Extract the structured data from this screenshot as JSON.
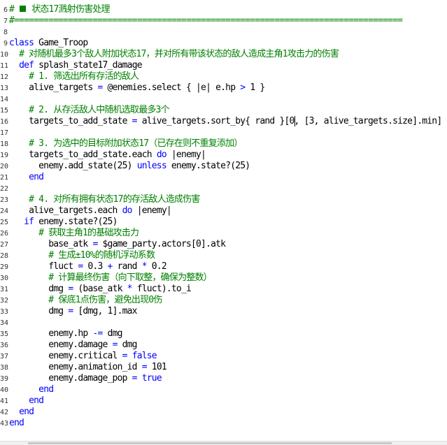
{
  "editor": {
    "language": "Ruby (RGSS script)",
    "colors": {
      "comment": "#008000",
      "keyword": "#0000ff",
      "text": "#000000",
      "background": "#ffffff"
    },
    "caret": {
      "line": 16
    },
    "lines": [
      {
        "num": "6",
        "tokens": [
          {
            "t": "comment",
            "v": "# "
          },
          {
            "t": "icon",
            "v": "■"
          },
          {
            "t": "comment",
            "v": " 状态17溅射伤害处理"
          }
        ]
      },
      {
        "num": "7",
        "tokens": [
          {
            "t": "comment",
            "v": "#==============================================================================="
          }
        ]
      },
      {
        "num": "8",
        "tokens": []
      },
      {
        "num": "9",
        "tokens": [
          {
            "t": "keyword",
            "v": "class"
          },
          {
            "t": "text",
            "v": " Game_Troop"
          }
        ]
      },
      {
        "num": "10",
        "tokens": [
          {
            "t": "text",
            "v": "  "
          },
          {
            "t": "comment",
            "v": "# 对随机最多3个敌人附加状态17，并对所有带该状态的敌人造成主角1攻击力的伤害"
          }
        ]
      },
      {
        "num": "11",
        "tokens": [
          {
            "t": "text",
            "v": "  "
          },
          {
            "t": "keyword",
            "v": "def"
          },
          {
            "t": "text",
            "v": " splash_state17_damage"
          }
        ]
      },
      {
        "num": "12",
        "tokens": [
          {
            "t": "text",
            "v": "    "
          },
          {
            "t": "comment",
            "v": "# 1. 筛选出所有存活的敌人"
          }
        ]
      },
      {
        "num": "13",
        "tokens": [
          {
            "t": "text",
            "v": "    alive_targets "
          },
          {
            "t": "keyword",
            "v": "="
          },
          {
            "t": "text",
            "v": " @enemies.select { |e| e.hp "
          },
          {
            "t": "keyword",
            "v": ">"
          },
          {
            "t": "text",
            "v": " 1 }"
          }
        ]
      },
      {
        "num": "14",
        "tokens": []
      },
      {
        "num": "15",
        "tokens": [
          {
            "t": "text",
            "v": "    "
          },
          {
            "t": "comment",
            "v": "# 2. 从存活敌人中随机选取最多3个"
          }
        ]
      },
      {
        "num": "16",
        "tokens": [
          {
            "t": "text",
            "v": "    targets_to_add_state "
          },
          {
            "t": "keyword",
            "v": "="
          },
          {
            "t": "text",
            "v": " alive_targets.sort_by{ rand }[0, [3, alive_targets.size].min]"
          }
        ]
      },
      {
        "num": "17",
        "tokens": []
      },
      {
        "num": "18",
        "tokens": [
          {
            "t": "text",
            "v": "    "
          },
          {
            "t": "comment",
            "v": "# 3. 为选中的目标附加状态17（已存在则不重复添加）"
          }
        ]
      },
      {
        "num": "19",
        "tokens": [
          {
            "t": "text",
            "v": "    targets_to_add_state.each "
          },
          {
            "t": "keyword",
            "v": "do"
          },
          {
            "t": "text",
            "v": " |enemy|"
          }
        ]
      },
      {
        "num": "20",
        "tokens": [
          {
            "t": "text",
            "v": "      enemy.add_state(25) "
          },
          {
            "t": "keyword",
            "v": "unless"
          },
          {
            "t": "text",
            "v": " enemy.state?(25)"
          }
        ]
      },
      {
        "num": "21",
        "tokens": [
          {
            "t": "text",
            "v": "    "
          },
          {
            "t": "keyword",
            "v": "end"
          }
        ]
      },
      {
        "num": "22",
        "tokens": []
      },
      {
        "num": "23",
        "tokens": [
          {
            "t": "text",
            "v": "    "
          },
          {
            "t": "comment",
            "v": "# 4. 对所有拥有状态17的存活敌人造成伤害"
          }
        ]
      },
      {
        "num": "24",
        "tokens": [
          {
            "t": "text",
            "v": "    alive_targets.each "
          },
          {
            "t": "keyword",
            "v": "do"
          },
          {
            "t": "text",
            "v": " |enemy|"
          }
        ]
      },
      {
        "num": "25",
        "tokens": [
          {
            "t": "text",
            "v": "   "
          },
          {
            "t": "keyword",
            "v": "if"
          },
          {
            "t": "text",
            "v": " enemy.state?(25)"
          }
        ]
      },
      {
        "num": "26",
        "tokens": [
          {
            "t": "text",
            "v": "      "
          },
          {
            "t": "comment",
            "v": "# 获取主角1的基础攻击力"
          }
        ]
      },
      {
        "num": "27",
        "tokens": [
          {
            "t": "text",
            "v": "        base_atk "
          },
          {
            "t": "keyword",
            "v": "="
          },
          {
            "t": "text",
            "v": " $game_party.actors[0].atk"
          }
        ]
      },
      {
        "num": "28",
        "tokens": [
          {
            "t": "text",
            "v": "        "
          },
          {
            "t": "comment",
            "v": "# 生成±10%的随机浮动系数"
          }
        ]
      },
      {
        "num": "29",
        "tokens": [
          {
            "t": "text",
            "v": "        fluct "
          },
          {
            "t": "keyword",
            "v": "="
          },
          {
            "t": "text",
            "v": " 0.3 "
          },
          {
            "t": "keyword",
            "v": "+"
          },
          {
            "t": "text",
            "v": " rand "
          },
          {
            "t": "keyword",
            "v": "*"
          },
          {
            "t": "text",
            "v": " 0.2"
          }
        ]
      },
      {
        "num": "30",
        "tokens": [
          {
            "t": "text",
            "v": "        "
          },
          {
            "t": "comment",
            "v": "# 计算最终伤害（向下取整，确保为整数）"
          }
        ]
      },
      {
        "num": "31",
        "tokens": [
          {
            "t": "text",
            "v": "        dmg "
          },
          {
            "t": "keyword",
            "v": "="
          },
          {
            "t": "text",
            "v": " (base_atk "
          },
          {
            "t": "keyword",
            "v": "*"
          },
          {
            "t": "text",
            "v": " fluct).to_i"
          }
        ]
      },
      {
        "num": "32",
        "tokens": [
          {
            "t": "text",
            "v": "        "
          },
          {
            "t": "comment",
            "v": "# 保底1点伤害，避免出现0伤"
          }
        ]
      },
      {
        "num": "33",
        "tokens": [
          {
            "t": "text",
            "v": "        dmg "
          },
          {
            "t": "keyword",
            "v": "="
          },
          {
            "t": "text",
            "v": " [dmg, 1].max"
          }
        ]
      },
      {
        "num": "34",
        "tokens": []
      },
      {
        "num": "35",
        "tokens": [
          {
            "t": "text",
            "v": "        enemy.hp "
          },
          {
            "t": "keyword",
            "v": "-="
          },
          {
            "t": "text",
            "v": " dmg"
          }
        ]
      },
      {
        "num": "36",
        "tokens": [
          {
            "t": "text",
            "v": "        enemy.damage "
          },
          {
            "t": "keyword",
            "v": "="
          },
          {
            "t": "text",
            "v": " dmg"
          }
        ]
      },
      {
        "num": "37",
        "tokens": [
          {
            "t": "text",
            "v": "        enemy.critical "
          },
          {
            "t": "keyword",
            "v": "="
          },
          {
            "t": "text",
            "v": " "
          },
          {
            "t": "keyword",
            "v": "false"
          }
        ]
      },
      {
        "num": "38",
        "tokens": [
          {
            "t": "text",
            "v": "        enemy.animation_id "
          },
          {
            "t": "keyword",
            "v": "="
          },
          {
            "t": "text",
            "v": " 101"
          }
        ]
      },
      {
        "num": "39",
        "tokens": [
          {
            "t": "text",
            "v": "        enemy.damage_pop "
          },
          {
            "t": "keyword",
            "v": "="
          },
          {
            "t": "text",
            "v": " "
          },
          {
            "t": "keyword",
            "v": "true"
          }
        ]
      },
      {
        "num": "40",
        "tokens": [
          {
            "t": "text",
            "v": "      "
          },
          {
            "t": "keyword",
            "v": "end"
          }
        ]
      },
      {
        "num": "41",
        "tokens": [
          {
            "t": "text",
            "v": "    "
          },
          {
            "t": "keyword",
            "v": "end"
          }
        ]
      },
      {
        "num": "42",
        "tokens": [
          {
            "t": "text",
            "v": "  "
          },
          {
            "t": "keyword",
            "v": "end"
          }
        ]
      },
      {
        "num": "43",
        "tokens": [
          {
            "t": "keyword",
            "v": "end"
          }
        ]
      }
    ]
  }
}
